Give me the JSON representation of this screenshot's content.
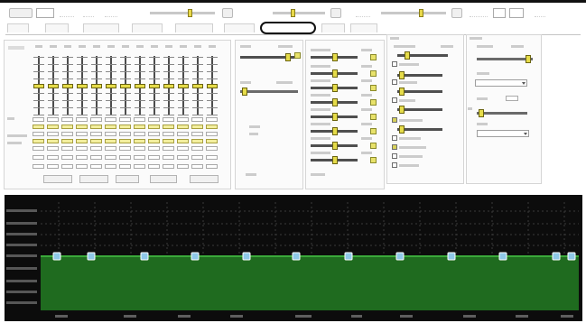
{
  "colors": {
    "accent": "#e6dc4a",
    "graph_bg": "#0c0c0c",
    "graph_fill": "#1f6b1f",
    "curve": "#3aa93a",
    "node": "#8fc8e8",
    "grid": "#3a3a3a"
  },
  "tabs": {
    "selected_index": 6
  },
  "eq": {
    "bands": [
      {
        "gain": 0
      },
      {
        "gain": 0
      },
      {
        "gain": 0
      },
      {
        "gain": 0
      },
      {
        "gain": 0
      },
      {
        "gain": 0
      },
      {
        "gain": 0
      },
      {
        "gain": 0
      }
    ]
  },
  "graph": {
    "level_fraction": 0.5,
    "node_count": 12
  }
}
